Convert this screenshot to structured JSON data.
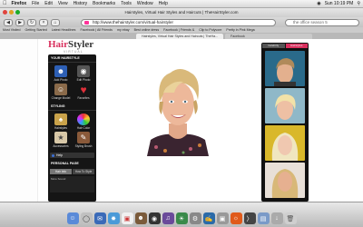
{
  "menubar": {
    "app": "Firefox",
    "items": [
      "File",
      "Edit",
      "View",
      "History",
      "Bookmarks",
      "Tools",
      "Window",
      "Help"
    ],
    "clock": "Sun 10:19 PM"
  },
  "window": {
    "title": "Hairstyles, Virtual Hair Styles and Haircuts | TheHairStyler.com"
  },
  "toolbar": {
    "url": "http://www.thehairstyler.com/virtual-hairstyler",
    "search_value": "the office season 5"
  },
  "bookmarks": [
    "Most Visited",
    "Getting Started",
    "Latest Headlines",
    "Facebook | All Friends",
    "my ebay",
    "Best online dress",
    "Facebook | Friends &",
    "Clip to Polyvore",
    "Pretty in Pink Mega"
  ],
  "tabs": [
    {
      "label": "Hairstyles, Virtual Hair Styles and Haircuts | TheHa..."
    },
    {
      "label": "Facebook"
    }
  ],
  "logo": {
    "hair": "Hair",
    "styler": "Styler",
    "sub": "VIRTUAL"
  },
  "panel": {
    "heading": "YOUR HAIRSTYLE",
    "tools": [
      {
        "label": "Add Photo",
        "icon": "person-icon"
      },
      {
        "label": "Edit Photo",
        "icon": "camera-icon"
      },
      {
        "label": "Change Model",
        "icon": "model-icon"
      },
      {
        "label": "Favorites",
        "icon": "heart-icon"
      }
    ],
    "styling_heading": "STYLING",
    "styling": [
      {
        "label": "Hairstyles",
        "icon": "hairstyles-icon"
      },
      {
        "label": "Hair Color",
        "icon": "color-wheel-icon"
      },
      {
        "label": "Accessories",
        "icon": "accessories-icon"
      },
      {
        "label": "Styling Brush",
        "icon": "brush-icon"
      }
    ],
    "help_label": "Help",
    "section": "PERSONAL PAGE",
    "subtabs": [
      "Hair Info",
      "How To Style"
    ],
    "list_label": "More Sound"
  },
  "thumbs": {
    "tabs": [
      "Celebrity",
      "Hairstyles"
    ]
  },
  "colors": {
    "brand": "#d9305e",
    "panel": "#151515"
  }
}
